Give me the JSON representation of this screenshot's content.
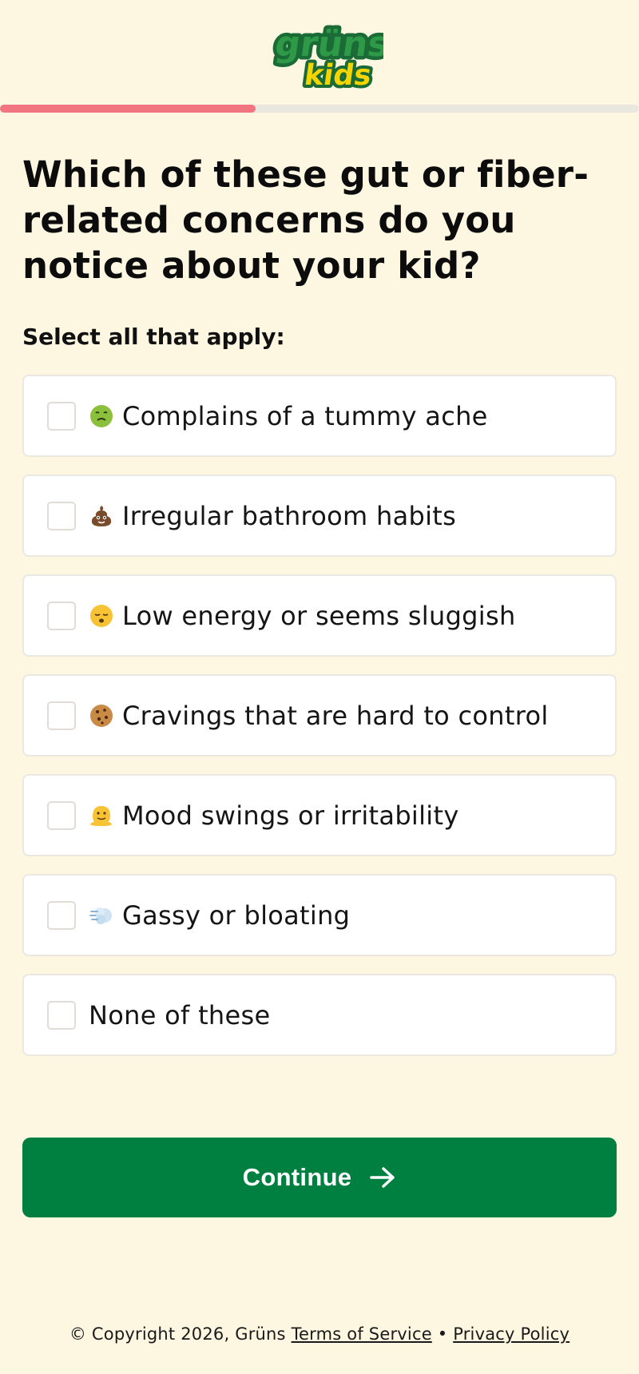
{
  "brand": {
    "logo_top": "grüns",
    "logo_bottom": "kids",
    "colors": {
      "green_dark": "#1a6b35",
      "green": "#2e9a48",
      "yellow": "#f5d400"
    }
  },
  "progress": {
    "fraction": 0.4,
    "color": "#f07580",
    "track_color": "#eae7df"
  },
  "question": {
    "title": "Which of these gut or fiber-related concerns do you notice about your kid?",
    "subtitle": "Select all that apply:"
  },
  "options": [
    {
      "icon": "nauseated-face-icon",
      "label": "Complains of a tummy ache",
      "checked": false
    },
    {
      "icon": "pile-of-poo-icon",
      "label": "Irregular bathroom habits",
      "checked": false
    },
    {
      "icon": "sleepy-face-icon",
      "label": "Low energy or seems sluggish",
      "checked": false
    },
    {
      "icon": "cookie-icon",
      "label": "Cravings that are hard to control",
      "checked": false
    },
    {
      "icon": "melting-face-icon",
      "label": "Mood swings or irritability",
      "checked": false
    },
    {
      "icon": "dashing-away-icon",
      "label": "Gassy or bloating",
      "checked": false
    },
    {
      "icon": null,
      "label": "None of these",
      "checked": false
    }
  ],
  "continue_button": {
    "label": "Continue",
    "color": "#008040",
    "icon": "arrow-right-icon"
  },
  "footer": {
    "copyright": "© Copyright 2026, Grüns",
    "separator": "•",
    "terms": "Terms of Service",
    "privacy": "Privacy Policy"
  }
}
